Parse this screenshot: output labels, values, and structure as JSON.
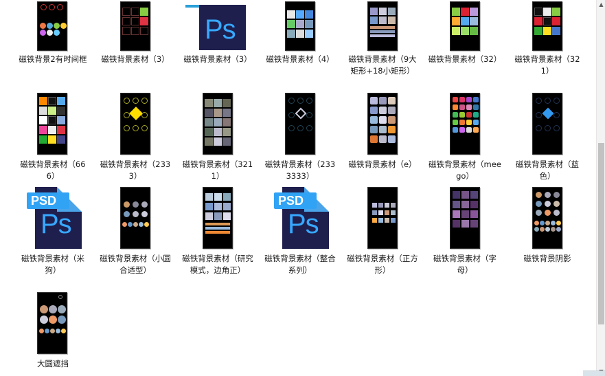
{
  "files": [
    {
      "label": "磁铁背景2有时间框"
    },
    {
      "label": "磁铁背景素材（3）"
    },
    {
      "label": "磁铁背景素材（3）"
    },
    {
      "label": "磁铁背景素材（4）"
    },
    {
      "label": "磁铁背景素材（9大矩形+18小矩形）"
    },
    {
      "label": "磁铁背景素材（32）"
    },
    {
      "label": "磁铁背景素材（321）"
    },
    {
      "label": "磁铁背景素材（666）"
    },
    {
      "label": "磁铁背景素材（2333）"
    },
    {
      "label": "磁铁背景素材（3211）"
    },
    {
      "label": "磁铁背景素材（2333333）"
    },
    {
      "label": "磁铁背景素材（e）"
    },
    {
      "label": "磁铁背景素材（meego）"
    },
    {
      "label": "磁铁背景素材（蓝色）"
    },
    {
      "label": "磁铁背景素材（米狗）"
    },
    {
      "label": "磁铁背景素材（小圆合适型）"
    },
    {
      "label": "磁铁背景素材（研究模式，边角正）"
    },
    {
      "label": "磁铁背景素材（整合系列）"
    },
    {
      "label": "磁铁背景素材（正方形）"
    },
    {
      "label": "磁铁背景素材（字母）"
    },
    {
      "label": "磁铁背景阴影"
    },
    {
      "label": "大圆遮挡"
    }
  ],
  "icons": {
    "psd_text": "PSD",
    "ps_text": "Ps"
  },
  "colors": {
    "ps_background": "#1f1f4e",
    "ps_letter": "#37a8ff",
    "psd_band": "#31a3f5",
    "phone_background": "#000000"
  }
}
